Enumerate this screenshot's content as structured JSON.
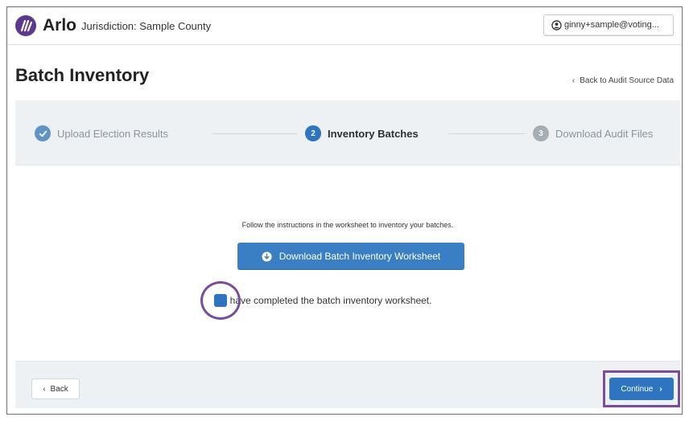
{
  "header": {
    "brand": "Arlo",
    "jurisdiction": "Jurisdiction: Sample County",
    "user_email": "ginny+sample@voting..."
  },
  "page": {
    "title": "Batch Inventory",
    "back_link": "Back to Audit Source Data"
  },
  "steps": [
    {
      "number": "1",
      "label": "Upload Election Results",
      "status": "completed"
    },
    {
      "number": "2",
      "label": "Inventory Batches",
      "status": "active"
    },
    {
      "number": "3",
      "label": "Download Audit Files",
      "status": "pending"
    }
  ],
  "main": {
    "instructions": "Follow the instructions in the worksheet to inventory your batches.",
    "download_button": "Download Batch Inventory Worksheet",
    "checkbox_label": "I have completed the batch inventory worksheet.",
    "checkbox_checked": true
  },
  "footer": {
    "back_button": "Back",
    "continue_button": "Continue"
  },
  "colors": {
    "brand_purple": "#5b3a8e",
    "primary_blue": "#2f74c0",
    "highlight_ring": "#7a4d9c"
  },
  "icons": {
    "logo": "arlo-logo-icon",
    "user": "user-circle-icon",
    "step_done": "checkmark-icon",
    "download": "download-icon",
    "back": "chevron-left-icon",
    "continue": "chevron-right-icon"
  }
}
